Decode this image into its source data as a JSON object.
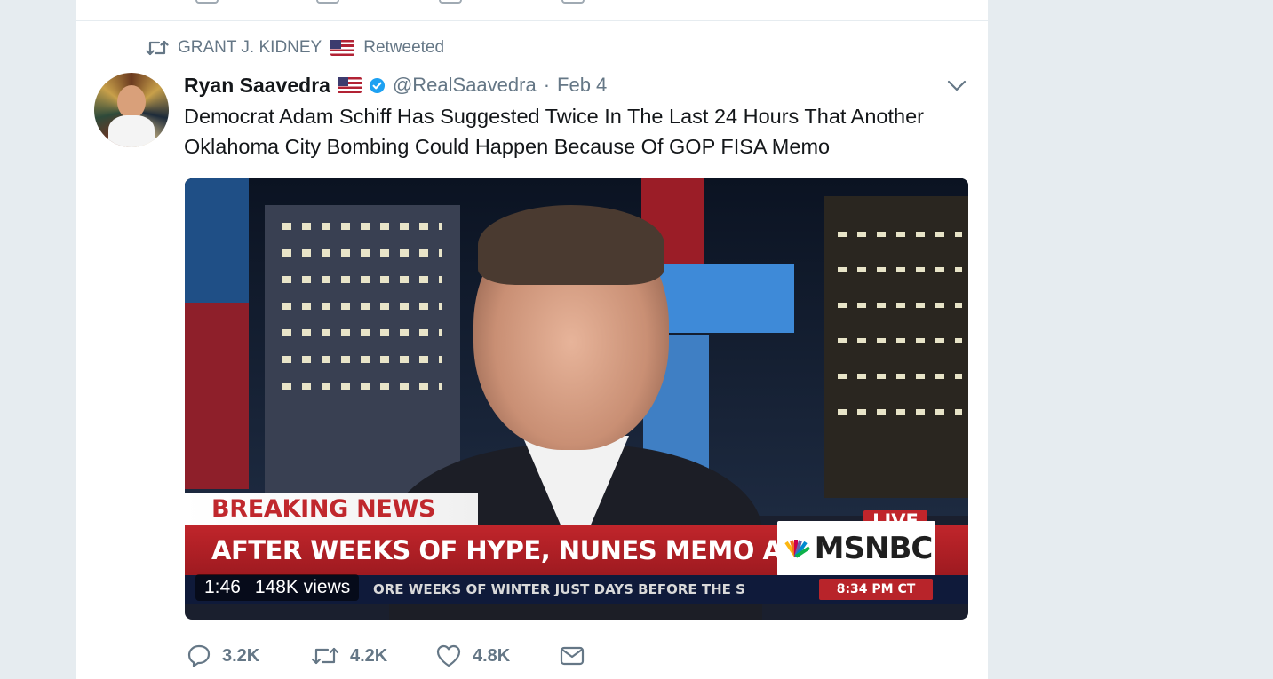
{
  "retweet_context": {
    "retweeter": "GRANT J. KIDNEY",
    "suffix": "Retweeted"
  },
  "tweet": {
    "author_name": "Ryan Saavedra",
    "handle": "@RealSaavedra",
    "separator": "·",
    "date": "Feb 4",
    "text": "Democrat Adam Schiff Has Suggested Twice In The Last 24 Hours That Another Oklahoma City Bombing Could Happen Because Of GOP FISA Memo"
  },
  "media": {
    "breaking_label": "BREAKING NEWS",
    "headline": "AFTER WEEKS OF HYPE, NUNES MEMO A DUD",
    "network": "MSNBC",
    "live_label": "LIVE",
    "ticker": "ORE WEEKS OF WINTER   JUST DAYS BEFORE THE S",
    "ticker_time": "8:34 PM CT",
    "duration": "1:46",
    "views": "148K views"
  },
  "actions": {
    "replies": "3.2K",
    "retweets": "4.2K",
    "likes": "4.8K"
  },
  "colors": {
    "text_primary": "#14171a",
    "text_secondary": "#657786",
    "verified_blue": "#1da1f2",
    "background": "#e6ecf0"
  },
  "icons": [
    "retweet-icon",
    "us-flag-icon",
    "verified-badge-icon",
    "chevron-down-icon",
    "reply-icon",
    "like-icon",
    "direct-message-icon"
  ]
}
